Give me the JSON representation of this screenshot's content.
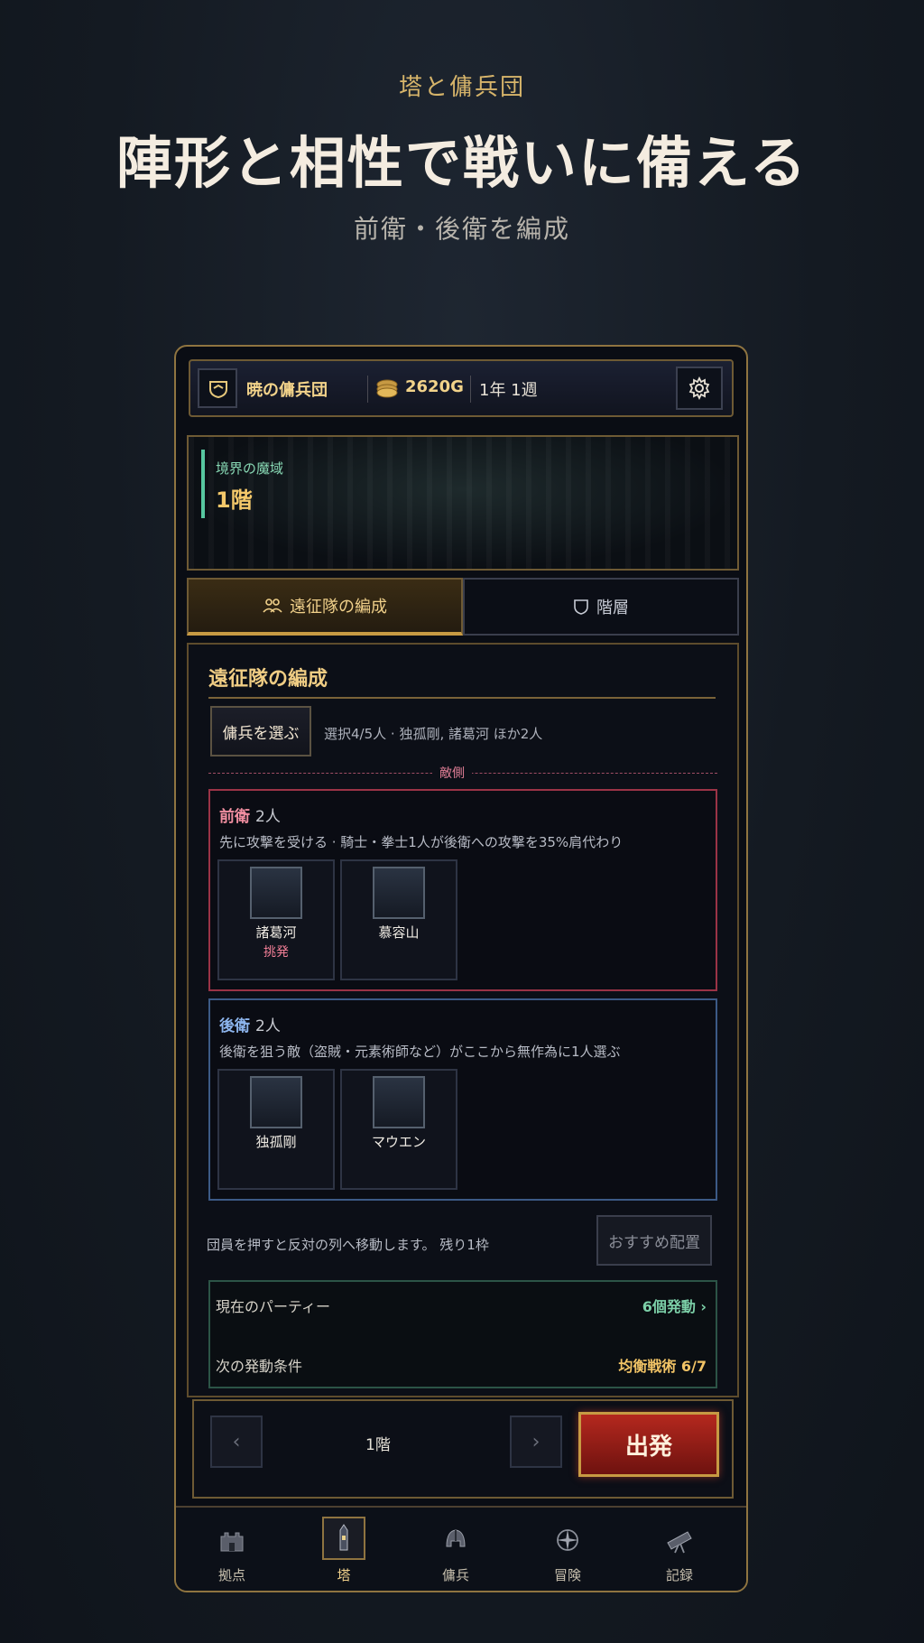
{
  "hero": {
    "subtitle": "塔と傭兵団",
    "title": "陣形と相性で戦いに備える",
    "caption": "前衛・後衛を編成"
  },
  "topbar": {
    "guild_name": "暁の傭兵団",
    "gold": "2620G",
    "date": "1年 1週"
  },
  "banner": {
    "area": "境界の魔域",
    "floor": "1階"
  },
  "tabs": [
    {
      "label": "遠征隊の編成",
      "icon": "party-icon",
      "active": true
    },
    {
      "label": "階層",
      "icon": "shield-icon",
      "active": false
    }
  ],
  "panel": {
    "title": "遠征隊の編成",
    "pick_button": "傭兵を選ぶ",
    "selection_info": "選択4/5人 · 独孤剛, 諸葛河 ほか2人",
    "enemy_label": "敵側",
    "front": {
      "name": "前衛",
      "count": "2人",
      "desc": "先に攻撃を受ける · 騎士・拳士1人が後衛への攻撃を35%肩代わり",
      "units": [
        {
          "name": "諸葛河",
          "tag": "挑発"
        },
        {
          "name": "慕容山",
          "tag": ""
        }
      ]
    },
    "back": {
      "name": "後衛",
      "count": "2人",
      "desc": "後衛を狙う敵（盗賊・元素術師など）がここから無作為に1人選ぶ",
      "units": [
        {
          "name": "独孤剛",
          "tag": ""
        },
        {
          "name": "マウエン",
          "tag": ""
        }
      ]
    },
    "move_info": "団員を押すと反対の列へ移動します。 残り1枠",
    "recommend_button": "おすすめ配置",
    "party": {
      "current_label": "現在のパーティー",
      "current_value": "6個発動 ›",
      "next_label": "次の発動条件",
      "next_value": "均衡戦術 6/7"
    }
  },
  "floor_bar": {
    "prev": "‹",
    "label": "1階",
    "next": "›",
    "depart_button": "出発"
  },
  "bottom_nav": [
    {
      "label": "拠点",
      "icon": "castle-icon",
      "active": false
    },
    {
      "label": "塔",
      "icon": "tower-icon",
      "active": true
    },
    {
      "label": "傭兵",
      "icon": "helmet-icon",
      "active": false
    },
    {
      "label": "冒険",
      "icon": "compass-icon",
      "active": false
    },
    {
      "label": "記録",
      "icon": "telescope-icon",
      "active": false
    }
  ],
  "colors": {
    "accent_gold": "#c79a43",
    "front_border": "#9b3346",
    "back_border": "#3c5a86",
    "depart_red": "#b4281e"
  }
}
